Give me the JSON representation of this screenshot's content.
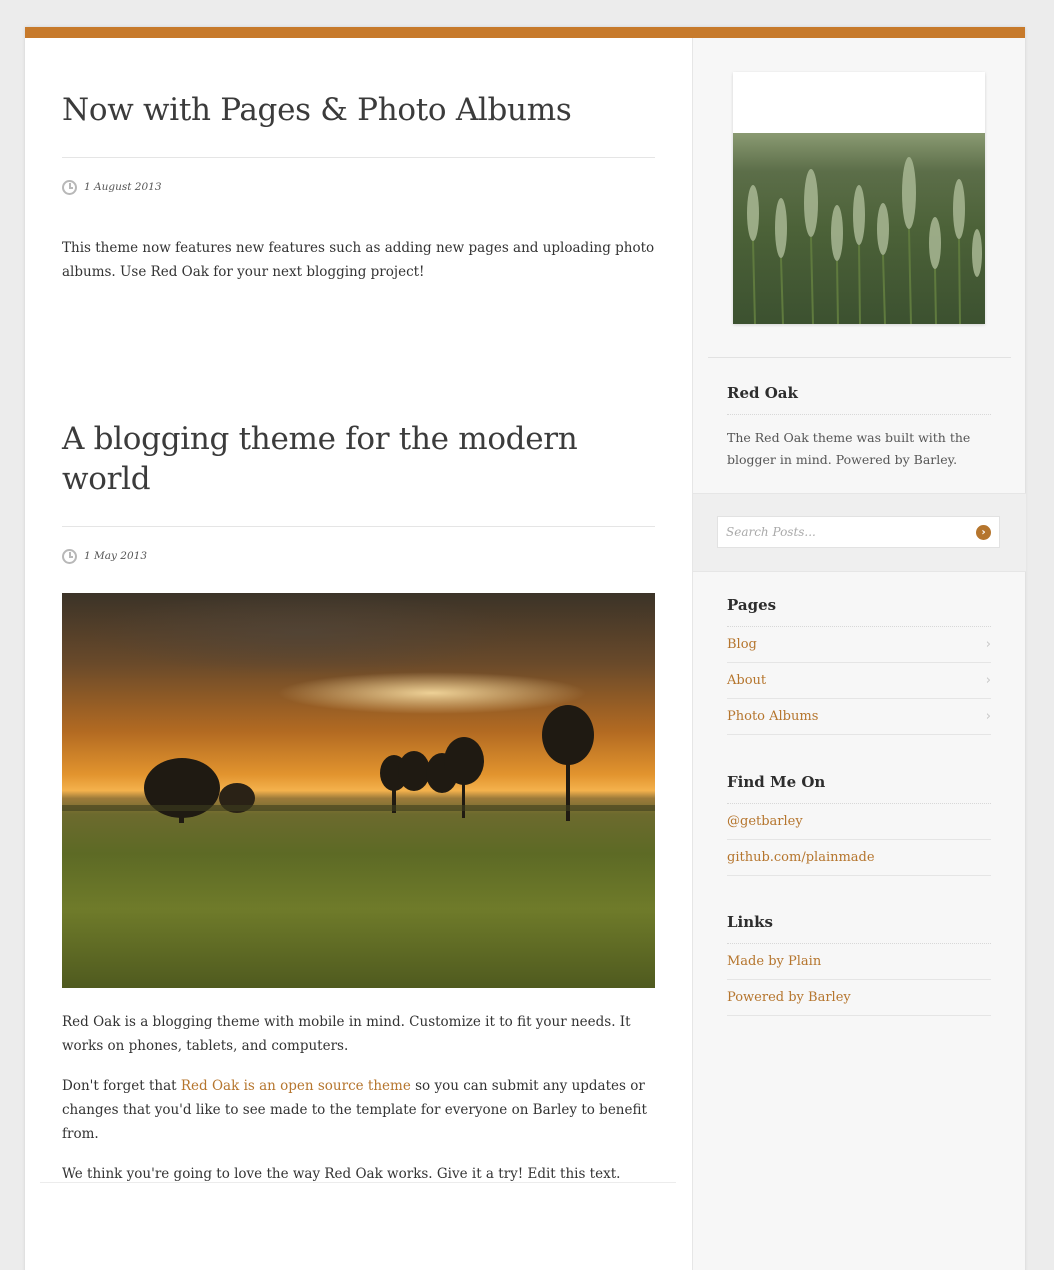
{
  "posts": [
    {
      "title": "Now with Pages & Photo Albums",
      "date": "1 August 2013",
      "paragraphs": [
        "This theme now features new features such as adding new pages and uploading photo albums. Use Red Oak for your next blogging project!"
      ]
    },
    {
      "title": "A blogging theme for the modern world",
      "date": "1 May 2013",
      "p1": "Red Oak is a blogging theme with mobile in mind. Customize it to fit your needs. It works on phones, tablets, and computers.",
      "p2_before": "Don't forget that ",
      "p2_link": "Red Oak is an open source theme",
      "p2_after": " so you can submit any updates or changes that you'd like to see made to the template for everyone on Barley to benefit from.",
      "p3": "We think you're going to love the way Red Oak works. Give it a try! Edit this text."
    }
  ],
  "sidebar": {
    "about": {
      "title": "Red Oak",
      "description": "The Red Oak theme was built with the blogger in mind. Powered by Barley."
    },
    "search": {
      "placeholder": "Search Posts..."
    },
    "pages": {
      "title": "Pages",
      "items": [
        {
          "label": "Blog"
        },
        {
          "label": "About"
        },
        {
          "label": "Photo Albums"
        }
      ]
    },
    "find_me": {
      "title": "Find Me On",
      "items": [
        {
          "label": "@getbarley"
        },
        {
          "label": "github.com/plainmade"
        }
      ]
    },
    "links": {
      "title": "Links",
      "items": [
        {
          "label": "Made by Plain"
        },
        {
          "label": "Powered by Barley"
        }
      ]
    }
  },
  "colors": {
    "accent": "#c77a2b",
    "link": "#b5752d"
  },
  "icons": {
    "date": "clock-icon",
    "chevron": "chevron-right-icon",
    "search_go": "arrow-circle-icon"
  }
}
